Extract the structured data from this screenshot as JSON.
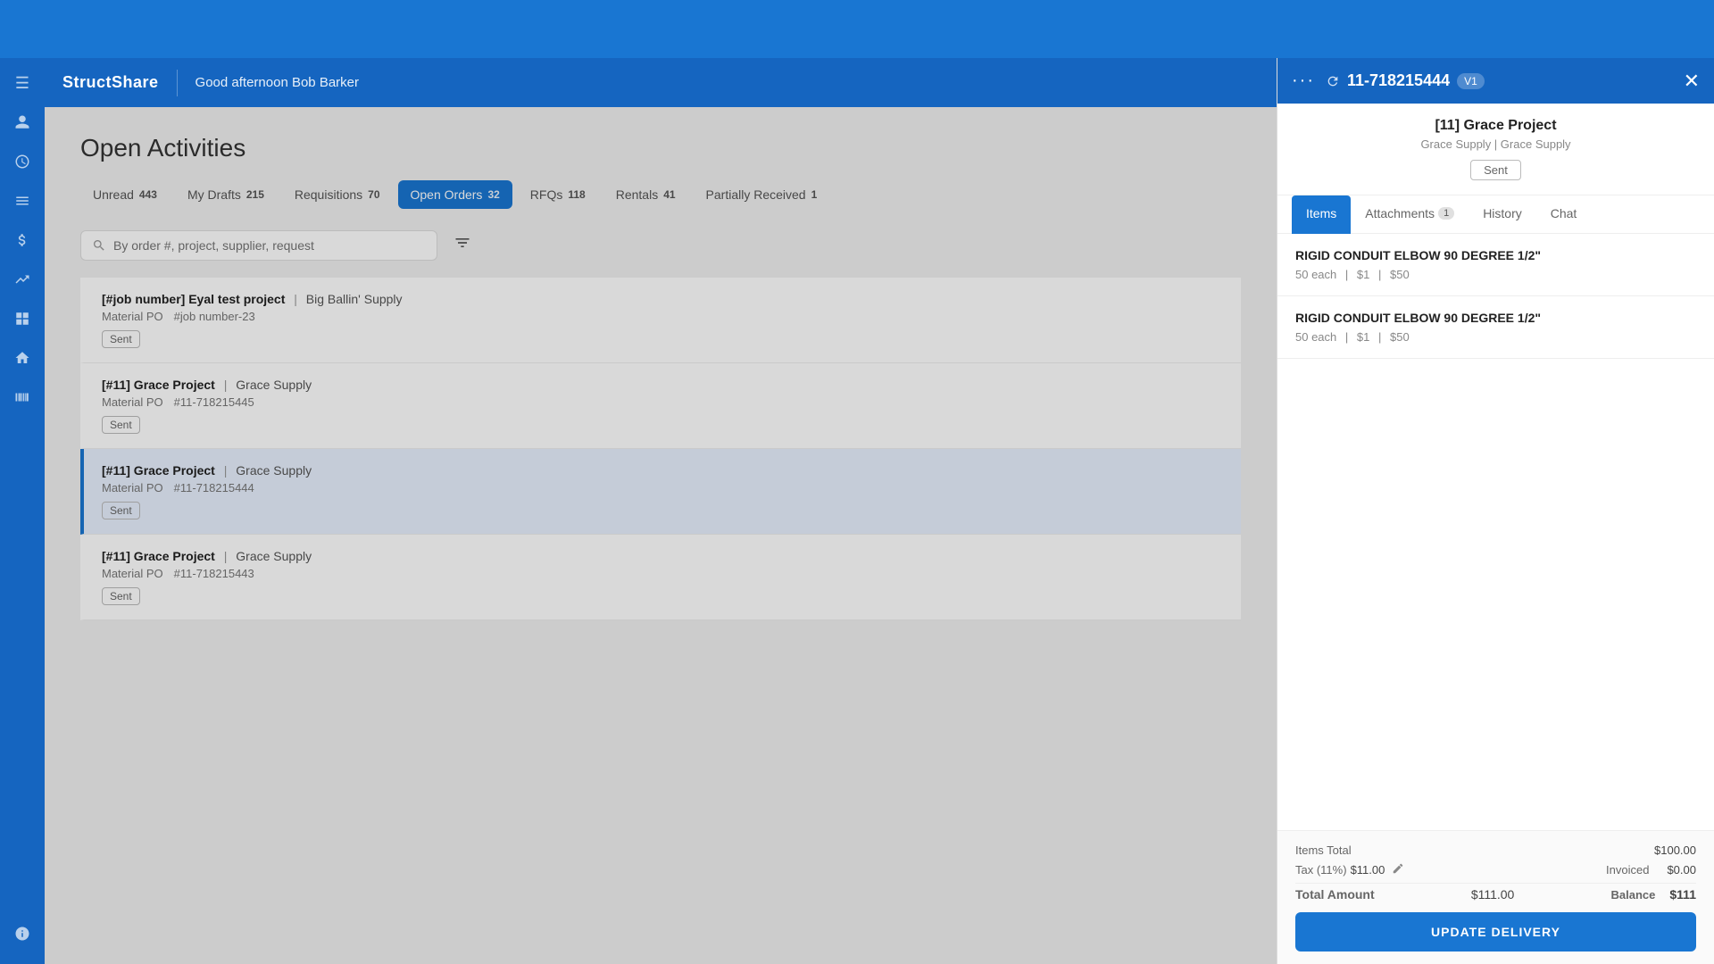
{
  "header": {
    "logo": "StructShare",
    "greeting": "Good afternoon Bob Barker"
  },
  "sidebar": {
    "icons": [
      {
        "name": "menu-icon",
        "glyph": "☰"
      },
      {
        "name": "person-icon",
        "glyph": "👤"
      },
      {
        "name": "history-icon",
        "glyph": "🕐"
      },
      {
        "name": "list-icon",
        "glyph": "☰"
      },
      {
        "name": "dollar-icon",
        "glyph": "💲"
      },
      {
        "name": "chart-icon",
        "glyph": "📊"
      },
      {
        "name": "grid-icon",
        "glyph": "⊞"
      },
      {
        "name": "building-icon",
        "glyph": "🏠"
      },
      {
        "name": "barcode-icon",
        "glyph": "|||"
      },
      {
        "name": "info-icon",
        "glyph": "ℹ"
      }
    ]
  },
  "page": {
    "title": "Open Activities",
    "tabs": [
      {
        "label": "Unread",
        "badge": "443",
        "active": false
      },
      {
        "label": "My Drafts",
        "badge": "215",
        "active": false
      },
      {
        "label": "Requisitions",
        "badge": "70",
        "active": false
      },
      {
        "label": "Open Orders",
        "badge": "32",
        "active": true
      },
      {
        "label": "RFQs",
        "badge": "118",
        "active": false
      },
      {
        "label": "Rentals",
        "badge": "41",
        "active": false
      },
      {
        "label": "Partially Received",
        "badge": "1",
        "active": false
      }
    ],
    "search_placeholder": "By order #, project, supplier, request"
  },
  "orders": [
    {
      "id": "order-1",
      "title": "[#job number] Eyal test project",
      "separator": "|",
      "supplier": "Big Ballin' Supply",
      "type": "Material PO",
      "number": "#job number-23",
      "status": "Sent",
      "selected": false
    },
    {
      "id": "order-2",
      "title": "[#11] Grace Project",
      "separator": "|",
      "supplier": "Grace Supply",
      "type": "Material PO",
      "number": "#11-718215445",
      "status": "Sent",
      "selected": false
    },
    {
      "id": "order-3",
      "title": "[#11] Grace Project",
      "separator": "|",
      "supplier": "Grace Supply",
      "type": "Material PO",
      "number": "#11-718215444",
      "status": "Sent",
      "selected": true
    },
    {
      "id": "order-4",
      "title": "[#11] Grace Project",
      "separator": "|",
      "supplier": "Grace Supply",
      "type": "Material PO",
      "number": "#11-718215443",
      "status": "Sent",
      "selected": false
    }
  ],
  "panel": {
    "order_number": "11-718215444",
    "version": "V1",
    "project_name": "[11] Grace Project",
    "project_sub": "Grace Supply | Grace Supply",
    "status": "Sent",
    "tabs": [
      {
        "label": "Items",
        "badge": null,
        "active": true
      },
      {
        "label": "Attachments",
        "badge": "1",
        "active": false
      },
      {
        "label": "History",
        "badge": null,
        "active": false
      },
      {
        "label": "Chat",
        "badge": null,
        "active": false
      }
    ],
    "items": [
      {
        "name": "RIGID CONDUIT ELBOW 90 DEGREE 1/2\"",
        "qty": "50 each",
        "unit_price": "$1",
        "total": "$50"
      },
      {
        "name": "RIGID CONDUIT ELBOW 90 DEGREE 1/2\"",
        "qty": "50 each",
        "unit_price": "$1",
        "total": "$50"
      }
    ],
    "footer": {
      "items_total_label": "Items Total",
      "items_total_value": "$100.00",
      "tax_label": "Tax (11%)",
      "tax_value": "$11.00",
      "invoiced_label": "Invoiced",
      "invoiced_value": "$0.00",
      "total_amount_label": "Total Amount",
      "total_amount_value": "$111.00",
      "balance_label": "Balance",
      "balance_value": "$111"
    },
    "update_delivery_label": "UPDATE DELIVERY"
  }
}
